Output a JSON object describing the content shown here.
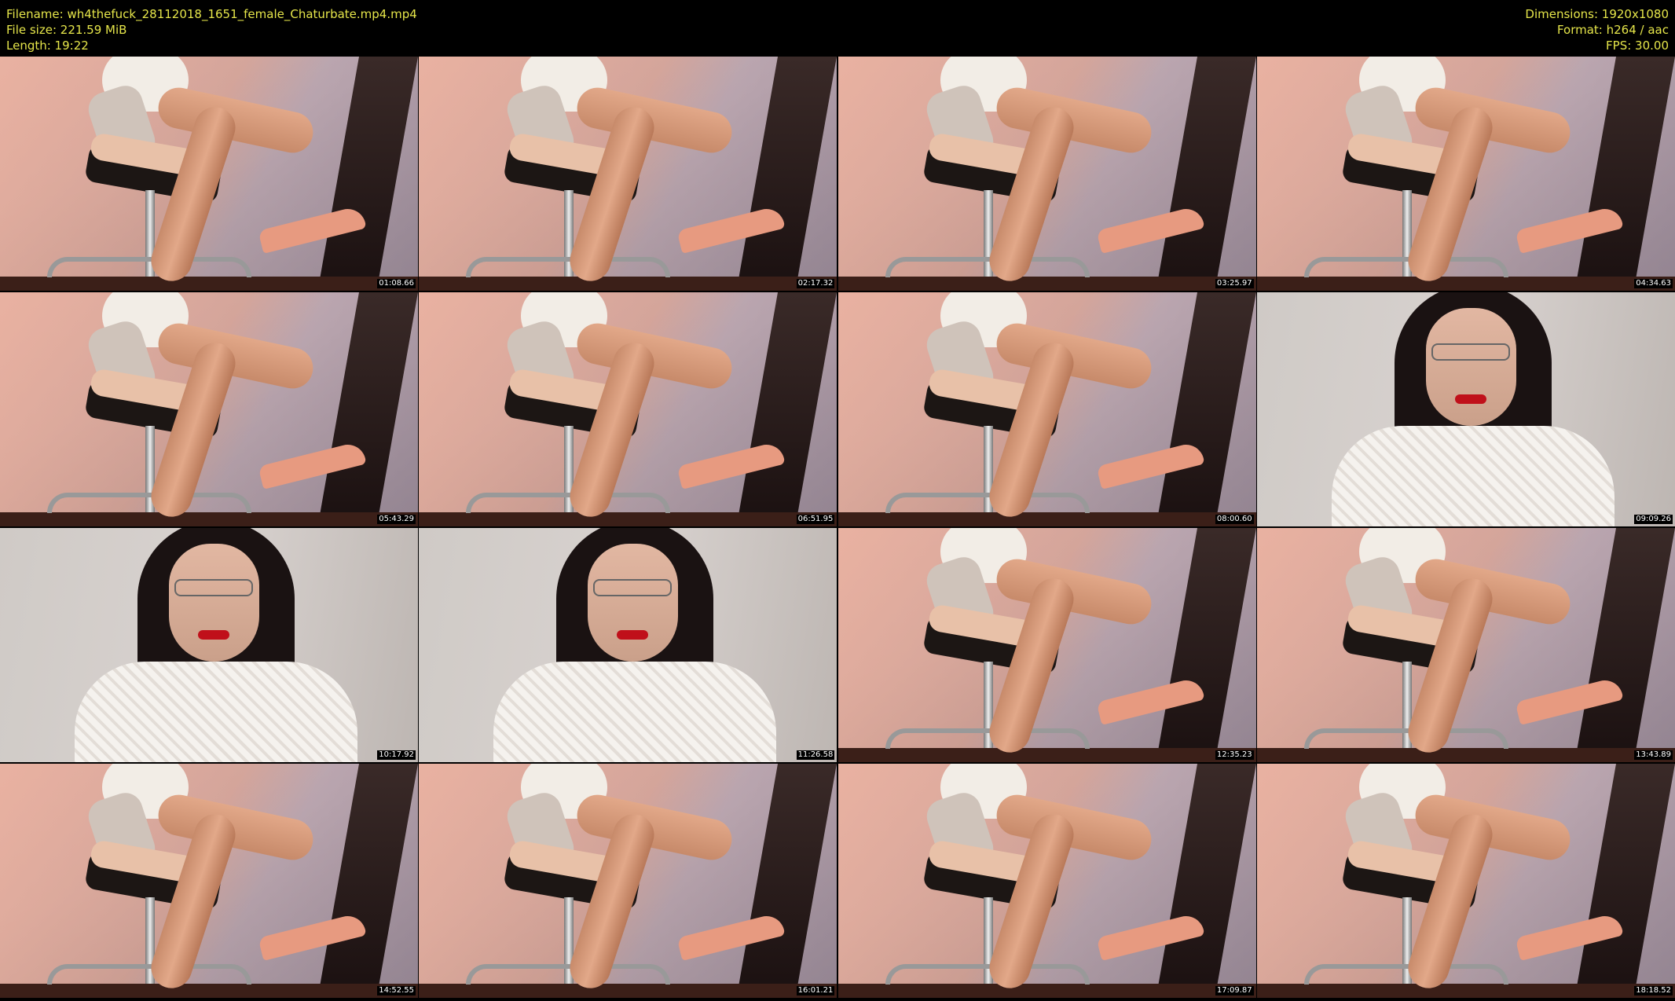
{
  "header": {
    "filename": "Filename: wh4thefuck_28112018_1651_female_Chaturbate.mp4.mp4",
    "filesize": "File size: 221.59 MiB",
    "length": "Length: 19:22",
    "dimensions": "Dimensions: 1920x1080",
    "format": "Format: h264 / aac",
    "fps": "FPS: 30.00"
  },
  "thumbnails": [
    {
      "time": "01:08.66",
      "type": "legs"
    },
    {
      "time": "02:17.32",
      "type": "legs"
    },
    {
      "time": "03:25.97",
      "type": "legs"
    },
    {
      "time": "04:34.63",
      "type": "legs"
    },
    {
      "time": "05:43.29",
      "type": "legs"
    },
    {
      "time": "06:51.95",
      "type": "legs"
    },
    {
      "time": "08:00.60",
      "type": "legs"
    },
    {
      "time": "09:09.26",
      "type": "face"
    },
    {
      "time": "10:17.92",
      "type": "face"
    },
    {
      "time": "11:26.58",
      "type": "face"
    },
    {
      "time": "12:35.23",
      "type": "legs"
    },
    {
      "time": "13:43.89",
      "type": "legs"
    },
    {
      "time": "14:52.55",
      "type": "legs"
    },
    {
      "time": "16:01.21",
      "type": "legs"
    },
    {
      "time": "17:09.87",
      "type": "legs"
    },
    {
      "time": "18:18.52",
      "type": "legs"
    }
  ]
}
